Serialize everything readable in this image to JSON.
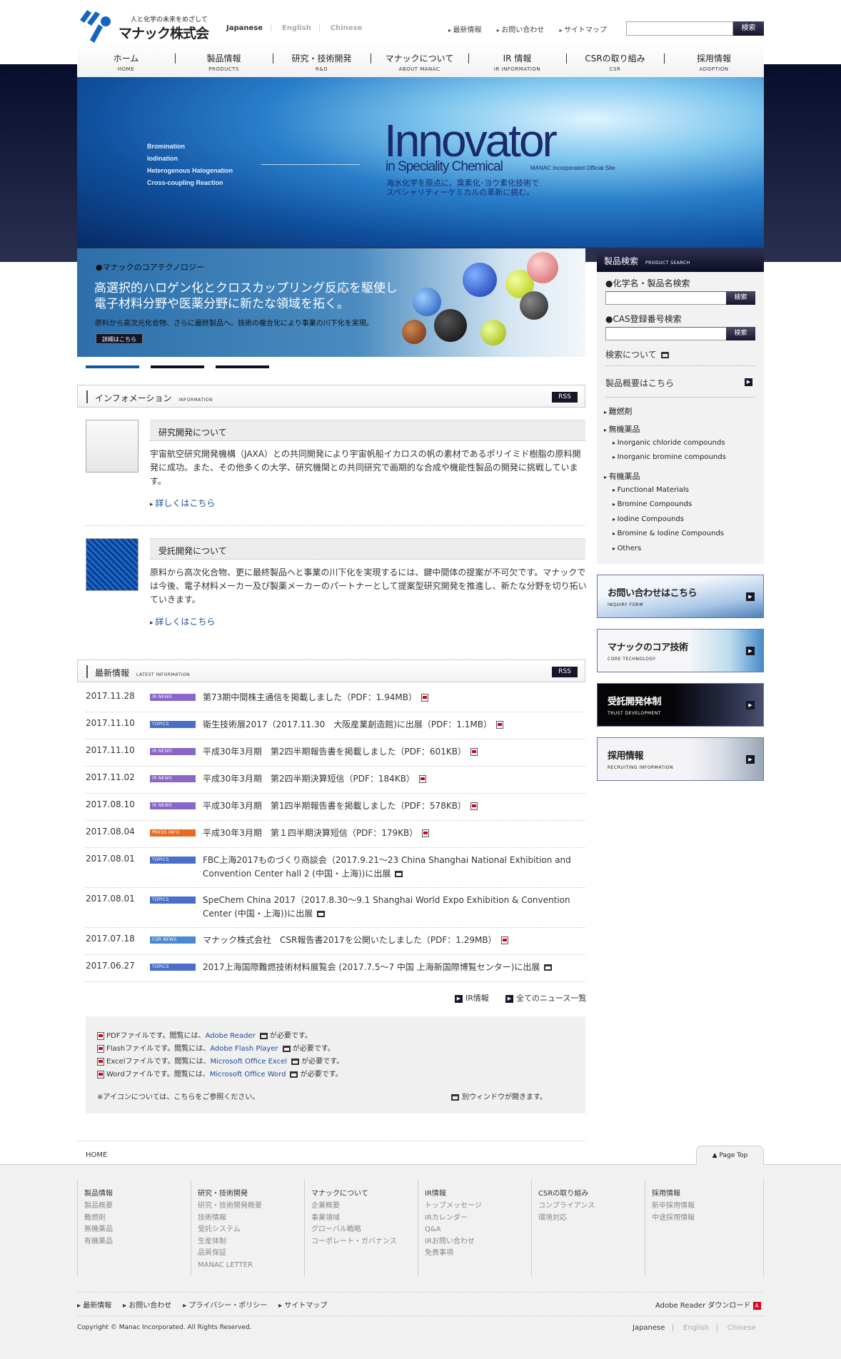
{
  "header": {
    "logo_tagline": "人と化学の未来をめざして",
    "logo_name": "マナック株式会社",
    "languages": [
      "Japanese",
      "English",
      "Chinese"
    ],
    "top_links": [
      "最新情報",
      "お問い合わせ",
      "サイトマップ"
    ],
    "search_placeholder": "",
    "search_button": "検索"
  },
  "nav": [
    {
      "jp": "ホーム",
      "en": "HOME"
    },
    {
      "jp": "製品情報",
      "en": "PRODUCTS"
    },
    {
      "jp": "研究・技術開発",
      "en": "R&D"
    },
    {
      "jp": "マナックについて",
      "en": "ABOUT MANAC"
    },
    {
      "jp": "IR 情報",
      "en": "IR INFORMATION"
    },
    {
      "jp": "CSRの取り組み",
      "en": "CSR"
    },
    {
      "jp": "採用情報",
      "en": "ADOPTION"
    }
  ],
  "hero": {
    "list": [
      "Bromination",
      "Iodination",
      "Heterogenous Halogenation",
      "Cross-coupling Reaction"
    ],
    "title": "Innovator",
    "subtitle": "in Speciality Chemical",
    "site": "MANAC Incorporated Official Site",
    "jp_line1": "海水化学を原点に、臭素化･ヨウ素化技術で",
    "jp_line2": "スペシャリティーケミカルの革新に挑む。"
  },
  "core_banner": {
    "kicker": "●マナックのコアテクノロジー",
    "headline1": "高選択的ハロゲン化とクロスカップリング反応を駆使し",
    "headline2": "電子材料分野や医薬分野に新たな領域を拓く。",
    "text": "原料から高次元化合物、さらに最終製品へ。技術の複合化により事業の川下化を実現。",
    "button": "詳細はこちら",
    "pager_count": 3,
    "pager_active": 1
  },
  "information": {
    "title": "インフォメーション",
    "title_en": "INFORMATION",
    "rss": "RSS",
    "items": [
      {
        "title": "研究開発について",
        "body": "宇宙航空研究開発機構（JAXA）との共同開発により宇宙帆船イカロスの帆の素材であるポリイミド樹脂の原料開発に成功。また、その他多くの大学、研究機関との共同研究で画期的な合成や機能性製品の開発に挑戦しています。",
        "link": "詳しくはこちら"
      },
      {
        "title": "受託開発について",
        "body": "原料から高次化合物、更に最終製品へと事業の川下化を実現するには、鍵中間体の提案が不可欠です。マナックでは今後、電子材料メーカー及び製薬メーカーのパートナーとして提案型研究開発を推進し、新たな分野を切り拓いていきます。",
        "link": "詳しくはこちら"
      }
    ]
  },
  "news": {
    "title": "最新情報",
    "title_en": "LATEST INFORMATION",
    "rss": "RSS",
    "badge_colors": {
      "IR NEWS": "#8a66c8",
      "TOPICS": "#4a6fc8",
      "PRESS INFO": "#e86a20",
      "CSR NEWS": "#4a8ad0"
    },
    "items": [
      {
        "date": "2017.11.28",
        "badge": "IR NEWS",
        "text": "第73期中間株主通信を掲載しました（PDF：1.94MB）",
        "icon": "pdf"
      },
      {
        "date": "2017.11.10",
        "badge": "TOPICS",
        "text": "衛生技術展2017（2017.11.30　大阪産業創造館)に出展（PDF：1.1MB）",
        "icon": "pdf"
      },
      {
        "date": "2017.11.10",
        "badge": "IR NEWS",
        "text": "平成30年3月期　第2四半期報告書を掲載しました（PDF：601KB）",
        "icon": "pdf"
      },
      {
        "date": "2017.11.02",
        "badge": "IR NEWS",
        "text": "平成30年3月期　第2四半期決算短信（PDF：184KB）",
        "icon": "pdf"
      },
      {
        "date": "2017.08.10",
        "badge": "IR NEWS",
        "text": "平成30年3月期　第1四半期報告書を掲載しました（PDF：578KB）",
        "icon": "pdf"
      },
      {
        "date": "2017.08.04",
        "badge": "PRESS INFO",
        "text": "平成30年3月期　第１四半期決算短信（PDF：179KB）",
        "icon": "pdf"
      },
      {
        "date": "2017.08.01",
        "badge": "TOPICS",
        "text": "FBC上海2017ものづくり商談会（2017.9.21～23 China Shanghai National Exhibition and Convention Center hall 2 (中国・上海))に出展",
        "icon": "window"
      },
      {
        "date": "2017.08.01",
        "badge": "TOPICS",
        "text": "SpeChem China 2017（2017.8.30～9.1 Shanghai World Expo Exhibition & Convention Center (中国・上海))に出展",
        "icon": "window"
      },
      {
        "date": "2017.07.18",
        "badge": "CSR NEWS",
        "text": "マナック株式会社　CSR報告書2017を公開いたしました（PDF：1.29MB）",
        "icon": "pdf"
      },
      {
        "date": "2017.06.27",
        "badge": "TOPICS",
        "text": "2017上海国際難燃技術材料展覧会 (2017.7.5～7 中国 上海新国際博覧センター)に出展",
        "icon": "window"
      }
    ],
    "links": [
      "IR情報",
      "全てのニュース一覧"
    ]
  },
  "legend": {
    "rows": [
      {
        "pre": "PDFファイルです。閲覧には、",
        "link": "Adobe Reader",
        "post": "が必要です。"
      },
      {
        "pre": "Flashファイルです。閲覧には、",
        "link": "Adobe Flash Player",
        "post": "が必要です。"
      },
      {
        "pre": "Excelファイルです。閲覧には、",
        "link": "Microsoft Office Excel",
        "post": "が必要です。"
      },
      {
        "pre": "Wordファイルです。閲覧には、",
        "link": "Microsoft Office Word",
        "post": "が必要です。"
      }
    ],
    "icon_note": "※アイコンについては、こちらをご参照ください。",
    "new_window": "別ウィンドウが開きます。"
  },
  "sidebar": {
    "title": "製品検索",
    "title_en": "PRODUCT SEARCH",
    "chem_label": "●化学名・製品名検索",
    "cas_label": "●CAS登録番号検索",
    "search_button": "検索",
    "about_search": "検索について",
    "overview": "製品概要はこちら",
    "tree": [
      {
        "label": "難燃剤",
        "children": []
      },
      {
        "label": "無機薬品",
        "children": [
          "Inorganic chloride compounds",
          "Inorganic bromine compounds"
        ]
      },
      {
        "label": "有機薬品",
        "children": [
          "Functional Materials",
          "Bromine Compounds",
          "Iodine Compounds",
          "Bromine & Iodine Compounds",
          "Others"
        ]
      }
    ],
    "banners": [
      {
        "jp": "お問い合わせはこちら",
        "en": "INQUIRY FORM"
      },
      {
        "jp": "マナックのコア技術",
        "en": "CORE TECHNOLOGY"
      },
      {
        "jp": "受託開発体制",
        "en": "TRUST DEVELOPMENT"
      },
      {
        "jp": "採用情報",
        "en": "RECRUITING INFORMATION"
      }
    ]
  },
  "footer": {
    "breadcrumb": "HOME",
    "page_top": "Page Top",
    "columns": [
      {
        "title": "製品情報",
        "items": [
          "製品概要",
          "難燃剤",
          "無機薬品",
          "有機薬品"
        ]
      },
      {
        "title": "研究・技術開発",
        "items": [
          "研究・技術開発概要",
          "技術情報",
          "受託システム",
          "生産体制",
          "品質保証",
          "MANAC LETTER"
        ]
      },
      {
        "title": "マナックについて",
        "items": [
          "企業概要",
          "事業領域",
          "グローバル戦略",
          "コーポレート・ガバナンス"
        ]
      },
      {
        "title": "IR情報",
        "items": [
          "トップメッセージ",
          "IRカレンダー",
          "Q&A",
          "IRお問い合わせ",
          "免責事項"
        ]
      },
      {
        "title": "CSRの取り組み",
        "items": [
          "コンプライアンス",
          "環境対応"
        ]
      },
      {
        "title": "採用情報",
        "items": [
          "新卒採用情報",
          "中途採用情報"
        ]
      }
    ],
    "links": [
      "最新情報",
      "お問い合わせ",
      "プライバシー・ポリシー",
      "サイトマップ"
    ],
    "adobe": "Adobe Reader ダウンロード",
    "copyright": "Copyright © Manac Incorporated. All Rights Reserved.",
    "languages": [
      "Japanese",
      "English",
      "Chinese"
    ]
  }
}
